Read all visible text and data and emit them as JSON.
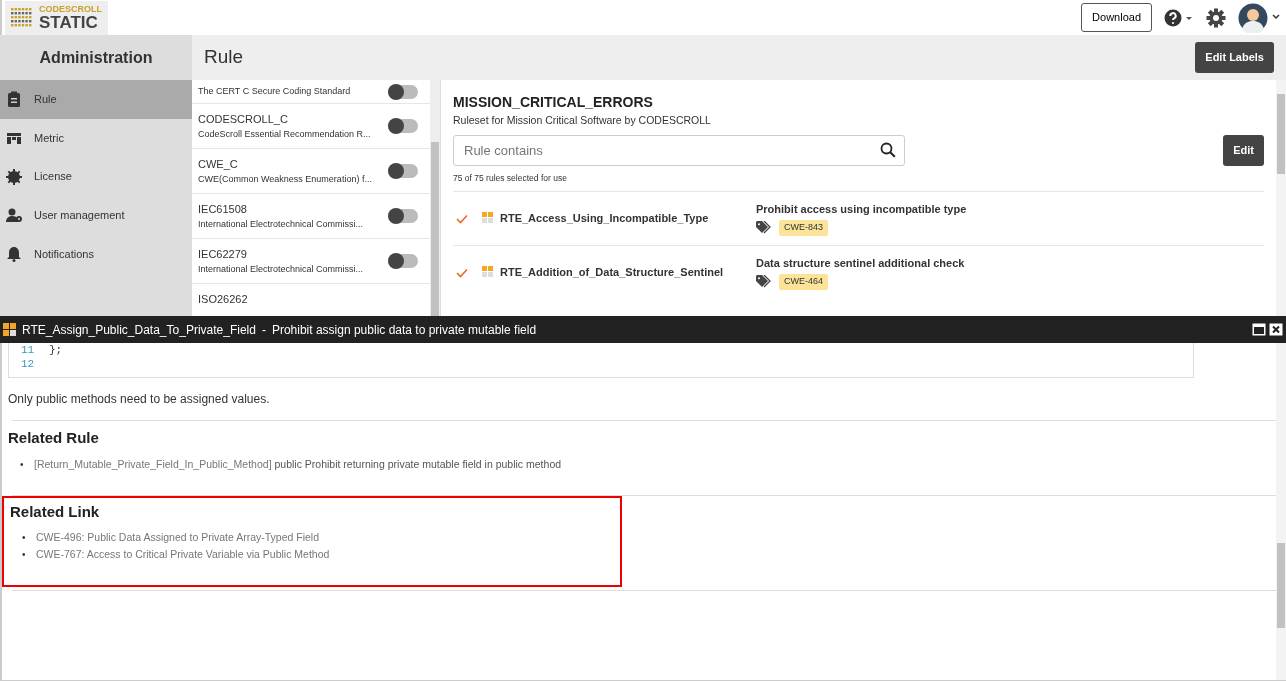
{
  "header": {
    "logo_top": "CODESCROLL",
    "logo_bottom": "STATIC",
    "download": "Download"
  },
  "sidebar": {
    "title": "Administration",
    "items": [
      {
        "label": "Rule",
        "kind": "clipboard",
        "selected": true
      },
      {
        "label": "Metric",
        "kind": "grid",
        "selected": false
      },
      {
        "label": "License",
        "kind": "badge",
        "selected": false
      },
      {
        "label": "User management",
        "kind": "usergear",
        "selected": false
      },
      {
        "label": "Notifications",
        "kind": "bell",
        "selected": false
      }
    ]
  },
  "page_title": "Rule",
  "edit_labels": "Edit Labels",
  "rulesets": [
    {
      "description": "The CERT C Secure Coding Standard",
      "on": false
    },
    {
      "name": "CODESCROLL_C",
      "description": "CodeScroll Essential Recommendation R...",
      "on": false
    },
    {
      "name": "CWE_C",
      "description": "CWE(Common Weakness Enumeration) f...",
      "on": false
    },
    {
      "name": "IEC61508",
      "description": "International Electrotechnical Commissi...",
      "on": false
    },
    {
      "name": "IEC62279",
      "description": "International Electrotechnical Commissi...",
      "on": false
    },
    {
      "name": "ISO26262"
    }
  ],
  "ruleset": {
    "title": "MISSION_CRITICAL_ERRORS",
    "subtitle": "Ruleset for Mission Critical Software by CODESCROLL",
    "search_placeholder": "Rule contains",
    "edit": "Edit",
    "count": "75 of 75 rules selected for use",
    "rules": [
      {
        "checked": true,
        "name": "RTE_Access_Using_Incompatible_Type",
        "description": "Prohibit access using incompatible type",
        "tag": "CWE-843"
      },
      {
        "checked": true,
        "name": "RTE_Addition_of_Data_Structure_Sentinel",
        "description": "Data structure sentinel additional check",
        "tag": "CWE-464"
      }
    ]
  },
  "detail": {
    "rule_name": "RTE_Assign_Public_Data_To_Private_Field",
    "separator": "-",
    "rule_title": "Prohibit assign public data to private mutable field",
    "code_lines": [
      {
        "number": "11",
        "code": "};"
      },
      {
        "number": "12"
      }
    ],
    "note": "Only public methods need to be assigned values.",
    "related_rule_heading": "Related Rule",
    "related_rules": [
      {
        "marker": "•",
        "link": "[Return_Mutable_Private_Field_In_Public_Method]",
        "text": "public Prohibit returning private mutable field in public method"
      }
    ],
    "related_link_heading": "Related Link",
    "related_links": [
      {
        "marker": "•",
        "text": "CWE-496: Public Data Assigned to Private Array-Typed Field"
      },
      {
        "marker": "•",
        "text": "CWE-767: Access to Critical Private Variable via Public Method"
      }
    ]
  }
}
